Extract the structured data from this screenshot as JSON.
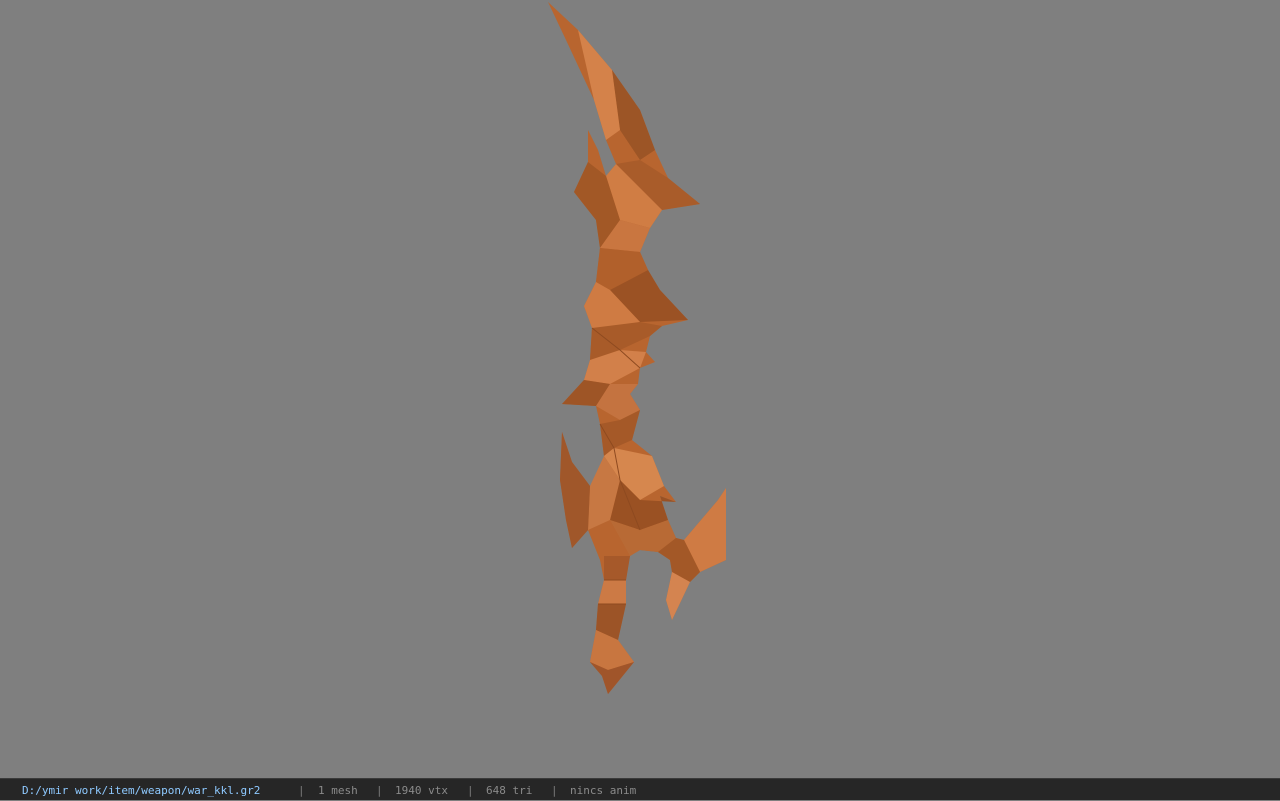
{
  "viewport": {
    "background_color": "#7f7f7f",
    "model_color": "#c0703a"
  },
  "status_bar": {
    "file_path": "D:/ymir work/item/weapon/war_kkl.gr2",
    "separator": "|",
    "mesh_count": "1 mesh",
    "vertex_count": "1940 vtx",
    "triangle_count": "648 tri",
    "animation": "nincs anim"
  }
}
